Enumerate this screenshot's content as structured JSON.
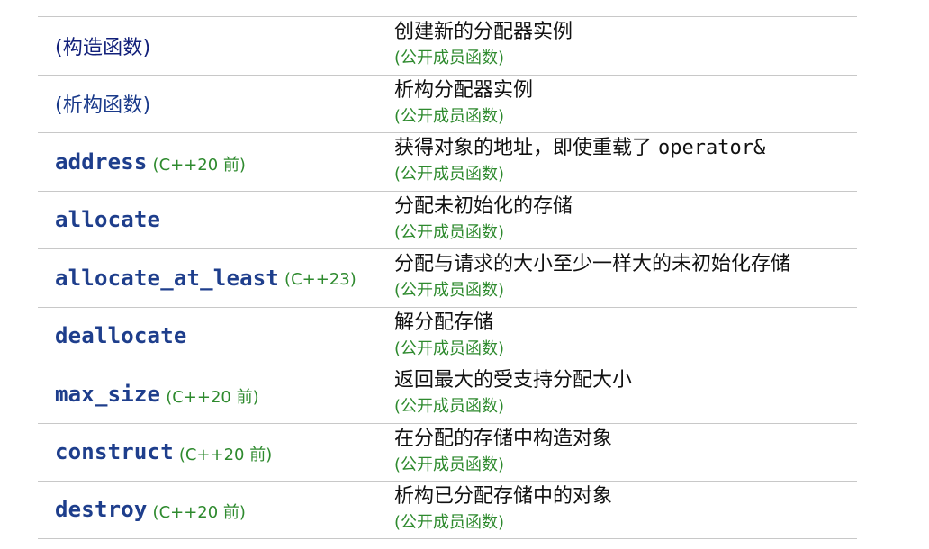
{
  "rows": [
    {
      "name": "(构造函数)",
      "version": "",
      "desc": "创建新的分配器实例",
      "desc_code": "",
      "kind": "(公开成员函数)"
    },
    {
      "name": "(析构函数)",
      "version": "",
      "desc": "析构分配器实例",
      "desc_code": "",
      "kind": "(公开成员函数)"
    },
    {
      "name": "address",
      "version": "(C++20 前)",
      "desc": "获得对象的地址，即使重载了 ",
      "desc_code": "operator&",
      "kind": "(公开成员函数)"
    },
    {
      "name": "allocate",
      "version": "",
      "desc": "分配未初始化的存储",
      "desc_code": "",
      "kind": "(公开成员函数)"
    },
    {
      "name": "allocate_at_least",
      "version": "(C++23)",
      "desc": "分配与请求的大小至少一样大的未初始化存储",
      "desc_code": "",
      "kind": "(公开成员函数)"
    },
    {
      "name": "deallocate",
      "version": "",
      "desc": "解分配存储",
      "desc_code": "",
      "kind": "(公开成员函数)"
    },
    {
      "name": "max_size",
      "version": "(C++20 前)",
      "desc": "返回最大的受支持分配大小",
      "desc_code": "",
      "kind": "(公开成员函数)"
    },
    {
      "name": "construct",
      "version": "(C++20 前)",
      "desc": "在分配的存储中构造对象",
      "desc_code": "",
      "kind": "(公开成员函数)"
    },
    {
      "name": "destroy",
      "version": "(C++20 前)",
      "desc": "析构已分配存储中的对象",
      "desc_code": "",
      "kind": "(公开成员函数)"
    }
  ]
}
